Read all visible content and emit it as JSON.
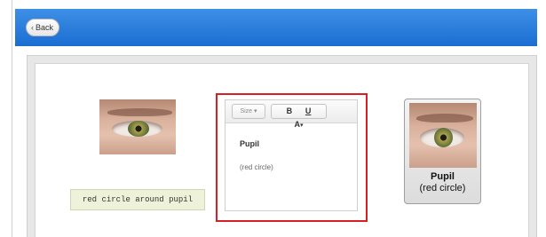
{
  "nav": {
    "back_label": "Back",
    "back_chevron": "‹"
  },
  "card_front": {
    "image_icon": "eye-photo",
    "caption": "red circle around pupil"
  },
  "editor": {
    "size_label": "Size",
    "size_caret": "▾",
    "bold_label": "B",
    "underline_label": "U",
    "color_label": "A",
    "color_caret": "▾",
    "title_text": "Pupil",
    "subtitle_text": "(red circle)",
    "highlight_color": "#d91f26"
  },
  "preview": {
    "image_icon": "eye-photo",
    "title": "Pupil",
    "subtitle": "(red circle)"
  },
  "colors": {
    "header_blue": "#1a6ed1",
    "caption_bg": "#eef2d9"
  }
}
